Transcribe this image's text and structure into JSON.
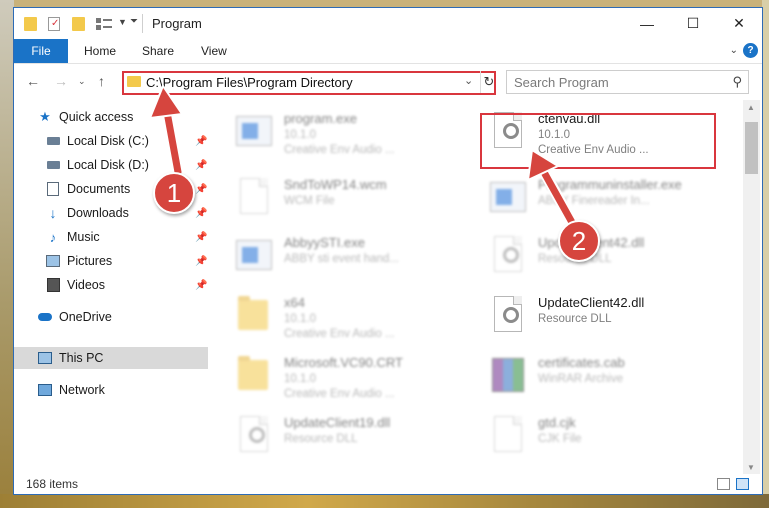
{
  "window": {
    "title": "Program",
    "minimize": "—",
    "maximize": "☐",
    "close": "✕"
  },
  "ribbon": {
    "tabs": [
      "File",
      "Home",
      "Share",
      "View"
    ],
    "help": "?"
  },
  "address": {
    "path": "C:\\Program Files\\Program Directory",
    "search_placeholder": "Search Program"
  },
  "sidebar": {
    "items": [
      {
        "label": "Quick access",
        "icon": "star-icon"
      },
      {
        "label": "Local Disk (C:)",
        "icon": "drive-icon",
        "pinned": true
      },
      {
        "label": "Local Disk (D:)",
        "icon": "drive-icon",
        "pinned": true
      },
      {
        "label": "Documents",
        "icon": "documents-icon",
        "pinned": true
      },
      {
        "label": "Downloads",
        "icon": "download-icon",
        "pinned": true
      },
      {
        "label": "Music",
        "icon": "music-icon",
        "pinned": true
      },
      {
        "label": "Pictures",
        "icon": "pictures-icon",
        "pinned": true
      },
      {
        "label": "Videos",
        "icon": "videos-icon",
        "pinned": true
      },
      {
        "label": "OneDrive",
        "icon": "cloud-icon"
      },
      {
        "label": "This PC",
        "icon": "computer-icon",
        "selected": true
      },
      {
        "label": "Network",
        "icon": "network-icon"
      }
    ]
  },
  "files": [
    {
      "name": "program.exe",
      "line1": "10.1.0",
      "line2": "Creative Env Audio ...",
      "icon": "application-icon",
      "blurred": true
    },
    {
      "name": "ctenvau.dll",
      "line1": "10.1.0",
      "line2": "Creative Env Audio ...",
      "icon": "dll-gear-icon",
      "blurred": false
    },
    {
      "name": "SndToWP14.wcm",
      "line1": "WCM File",
      "line2": "",
      "icon": "blank-file-icon",
      "blurred": true
    },
    {
      "name": "Programmuninstaller.exe",
      "line1": "ABBY Finereader In...",
      "line2": "",
      "icon": "application-icon",
      "blurred": true
    },
    {
      "name": "AbbyySTI.exe",
      "line1": "ABBY sti event hand...",
      "line2": "",
      "icon": "application-icon",
      "blurred": true
    },
    {
      "name": "UpdateClient42.dll",
      "line1": "Resource DLL",
      "line2": "",
      "icon": "dll-gear-icon",
      "blurred": true
    },
    {
      "name": "x64",
      "line1": "10.1.0",
      "line2": "Creative Env Audio ...",
      "icon": "folder-icon",
      "blurred": true
    },
    {
      "name": "UpdateClient42.dll",
      "line1": "Resource DLL",
      "line2": "",
      "icon": "dll-gear-icon",
      "blurred": true
    },
    {
      "name": "Microsoft.VC90.CRT",
      "line1": "10.1.0",
      "line2": "Creative Env Audio ...",
      "icon": "folder-icon",
      "blurred": true
    },
    {
      "name": "certificates.cab",
      "line1": "WinRAR Archive",
      "line2": "",
      "icon": "archive-icon",
      "blurred": true
    },
    {
      "name": "UpdateClient19.dll",
      "line1": "Resource DLL",
      "line2": "",
      "icon": "dll-gear-icon",
      "blurred": true
    },
    {
      "name": "gtd.cjk",
      "line1": "CJK File",
      "line2": "",
      "icon": "blank-file-icon",
      "blurred": true
    }
  ],
  "status": {
    "count": "168 items"
  },
  "annotations": {
    "badge1": "1",
    "badge2": "2"
  }
}
